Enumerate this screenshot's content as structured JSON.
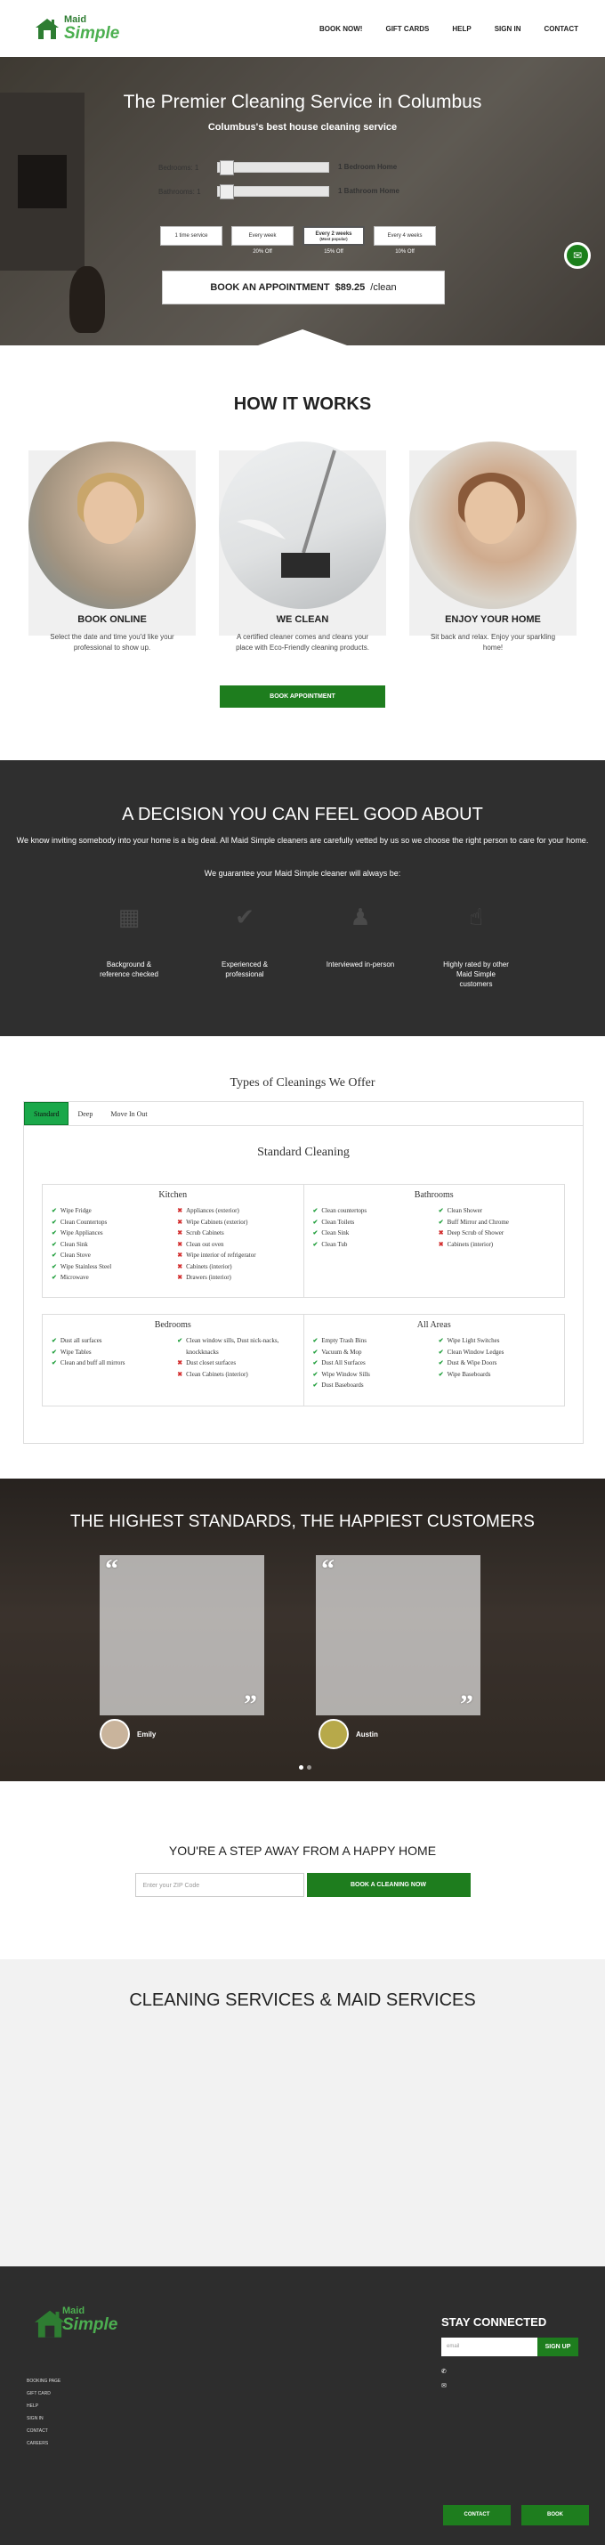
{
  "nav": {
    "logo_top": "Maid",
    "logo_bottom": "Simple",
    "items": [
      "BOOK NOW!",
      "GIFT CARDS",
      "HELP",
      "SIGN IN",
      "CONTACT"
    ]
  },
  "hero": {
    "title": "The Premier Cleaning Service in Columbus",
    "subtitle": "Columbus's best house cleaning service",
    "bedrooms_label": "Bedrooms: 1",
    "bedrooms_value": "1 Bedroom Home",
    "bedrooms_note": "",
    "bathrooms_label": "Bathrooms: 1",
    "bathrooms_value": "1 Bathroom Home",
    "bathrooms_note": "",
    "frequencies": [
      {
        "label": "1 time service",
        "sub": "",
        "pct": ""
      },
      {
        "label": "Every week",
        "sub": "",
        "pct": "20% Off"
      },
      {
        "label": "Every 2 weeks",
        "sub": "(Most popular)",
        "pct": "15% Off"
      },
      {
        "label": "Every 4 weeks",
        "sub": "",
        "pct": "10% Off"
      }
    ],
    "book_label": "BOOK AN APPOINTMENT",
    "book_price": "$89.25",
    "book_suffix": "/clean"
  },
  "how": {
    "title": "HOW IT WORKS",
    "cards": [
      {
        "title": "BOOK ONLINE",
        "text": "Select the date and time you'd like your professional to show up."
      },
      {
        "title": "WE CLEAN",
        "text": "A certified cleaner comes and cleans your place with Eco-Friendly cleaning products."
      },
      {
        "title": "ENJOY YOUR HOME",
        "text": "Sit back and relax. Enjoy your sparkling home!"
      }
    ],
    "button": "BOOK APPOINTMENT"
  },
  "decision": {
    "title": "A DECISION YOU CAN FEEL GOOD ABOUT",
    "p1": "We know inviting somebody into your home is a big deal. All Maid Simple cleaners are carefully vetted by us so we choose the right person to care for your home.",
    "p2": "We guarantee your Maid Simple cleaner will always be:",
    "items": [
      "Background & reference checked",
      "Experienced & professional",
      "Interviewed in-person",
      "Highly rated by other Maid Simple customers"
    ]
  },
  "types": {
    "title": "Types of Cleanings We Offer",
    "tabs": [
      "Standard",
      "Deep",
      "Move In Out"
    ],
    "heading": "Standard Cleaning",
    "subheading": "",
    "kitchen": {
      "title": "Kitchen",
      "left": [
        "Wipe Fridge",
        "Clean Countertops",
        "Wipe Appliances",
        "Clean Sink",
        "Clean Stove",
        "Wipe Stainless Steel",
        "Microwave"
      ],
      "right": [
        [
          "x",
          "Appliances (exterior)"
        ],
        [
          "x",
          "Wipe Cabinets (exterior)"
        ],
        [
          "x",
          "Scrub Cabinets"
        ],
        [
          "x",
          "Clean out oven"
        ],
        [
          "x",
          "Wipe interior of refrigerator"
        ],
        [
          "x",
          "Cabinets (interior)"
        ],
        [
          "x",
          "Drawers (interior)"
        ]
      ]
    },
    "bathrooms": {
      "title": "Bathrooms",
      "left": [
        "Clean countertops",
        "Clean Toilets",
        "Clean Sink",
        "Clean Tub"
      ],
      "right": [
        [
          "c",
          "Clean Shower"
        ],
        [
          "c",
          "Buff Mirror and Chrome"
        ],
        [
          "x",
          "Deep Scrub of Shower"
        ],
        [
          "x",
          "Cabinets (interior)"
        ]
      ]
    },
    "bedrooms": {
      "title": "Bedrooms",
      "left": [
        "Dust all surfaces",
        "Wipe Tables",
        "Clean and buff all mirrors"
      ],
      "right": [
        [
          "c",
          "Clean window sills, Dust nick-nacks, knockknacks"
        ],
        [
          "x",
          "Dust closet surfaces"
        ],
        [
          "x",
          "Clean Cabinets (interior)"
        ]
      ]
    },
    "allareas": {
      "title": "All Areas",
      "left": [
        "Empty Trash Bins",
        "Vacuum & Mop",
        "Dust All Surfaces",
        "Wipe Window Sills",
        "Dust Baseboards"
      ],
      "right": [
        [
          "c",
          "Wipe Light Switches"
        ],
        [
          "c",
          "Clean Window Ledges"
        ],
        [
          "c",
          "Dust & Wipe Doors"
        ],
        [
          "c",
          "Wipe Baseboards"
        ]
      ]
    }
  },
  "standards": {
    "title": "THE HIGHEST STANDARDS, THE HAPPIEST CUSTOMERS",
    "q1": "",
    "q1_name": "Emily",
    "q1_place": "",
    "q2": "",
    "q2_name": "Austin",
    "q2_place": ""
  },
  "step": {
    "title": "YOU'RE A STEP AWAY FROM A HAPPY HOME",
    "zip_placeholder": "Enter your ZIP Code",
    "button": "BOOK A CLEANING NOW"
  },
  "services": {
    "title": "CLEANING SERVICES & MAID SERVICES",
    "paragraphs": []
  },
  "footer": {
    "logo_top": "Maid",
    "logo_bottom": "Simple",
    "links": [
      "BOOKING PAGE",
      "GIFT CARD",
      "HELP",
      "SIGN IN",
      "CONTACT",
      "CAREERS"
    ],
    "stay": "STAY CONNECTED",
    "email_placeholder": "email",
    "signup": "SIGN UP",
    "phone1": "",
    "phone2": "",
    "email": "",
    "btn_contact": "CONTACT",
    "btn_book": "BOOK"
  }
}
